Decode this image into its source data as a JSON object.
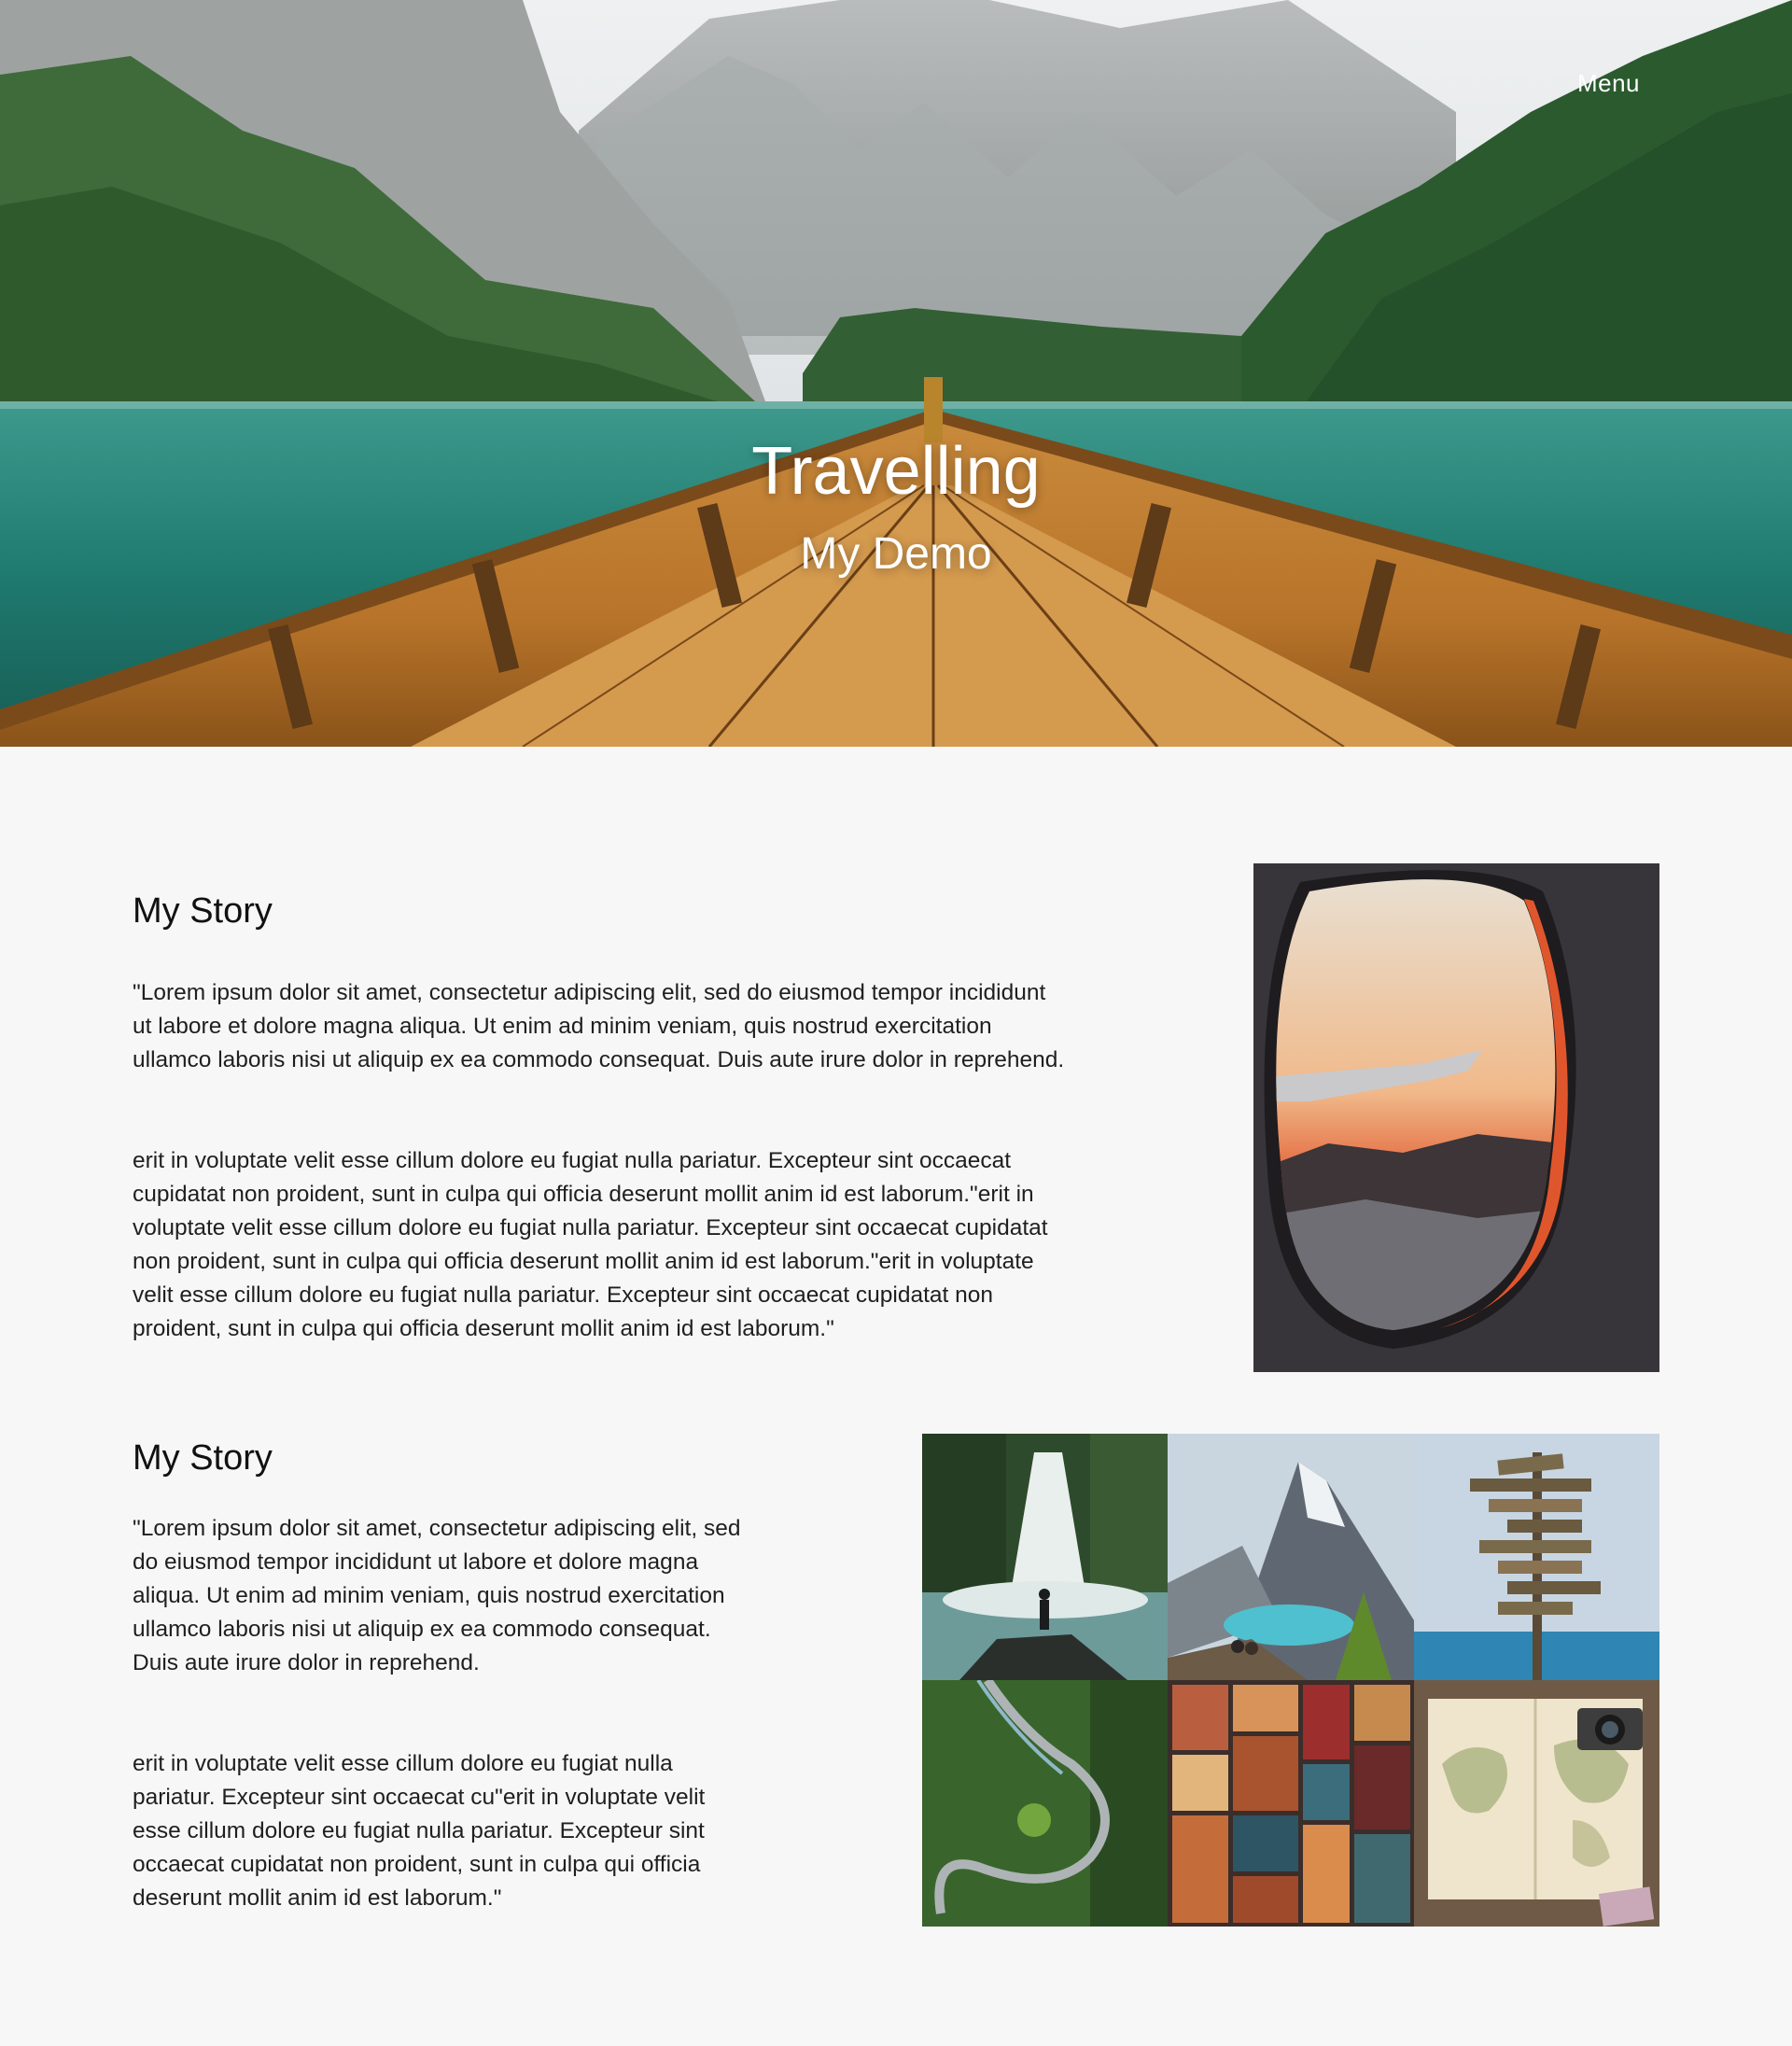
{
  "nav": {
    "menu_label": "Menu"
  },
  "hero": {
    "title": "Travelling",
    "subtitle": "My Demo"
  },
  "sections": [
    {
      "heading": "My Story",
      "paragraphs": [
        "\"Lorem ipsum dolor sit amet, consectetur adipiscing elit, sed do eiusmod tempor incididunt ut labore et dolore magna aliqua. Ut enim ad minim veniam, quis nostrud exercitation ullamco laboris nisi ut aliquip ex ea commodo consequat. Duis aute irure dolor in reprehend.",
        "erit in voluptate velit esse cillum dolore eu fugiat nulla pariatur. Excepteur sint occaecat cupidatat non proident, sunt in culpa qui officia deserunt mollit anim id est laborum.\"erit in voluptate velit esse cillum dolore eu fugiat nulla pariatur. Excepteur sint occaecat cupidatat non proident, sunt in culpa qui officia deserunt mollit anim id est laborum.\"erit in voluptate velit esse cillum dolore eu fugiat nulla pariatur. Excepteur sint occaecat cupidatat non proident, sunt in culpa qui officia deserunt mollit anim id est laborum.\""
      ]
    },
    {
      "heading": "My Story",
      "paragraphs": [
        "\"Lorem ipsum dolor sit amet, consectetur adipiscing elit, sed do eiusmod tempor incididunt ut labore et dolore magna aliqua. Ut enim ad minim veniam, quis nostrud exercitation ullamco laboris nisi ut aliquip ex ea commodo consequat. Duis aute irure dolor in reprehend.",
        "erit in voluptate velit esse cillum dolore eu fugiat nulla pariatur. Excepteur sint occaecat cu\"erit in voluptate velit esse cillum dolore eu fugiat nulla pariatur. Excepteur sint occaecat cupidatat non proident, sunt in culpa qui officia deserunt mollit anim id est laborum.\""
      ]
    }
  ],
  "colors": {
    "page_background": "#f7f7f7",
    "hero_text": "#ffffff",
    "body_text": "#1f1f1f"
  }
}
